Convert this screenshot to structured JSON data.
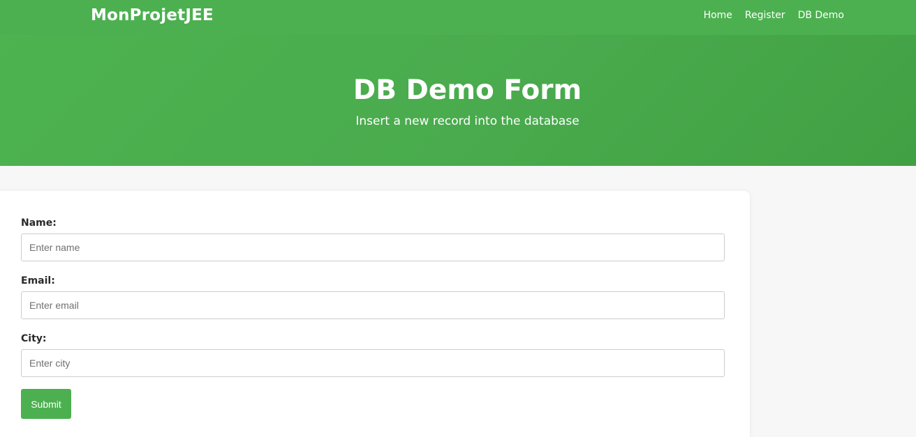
{
  "navbar": {
    "brand": "MonProjetJEE",
    "links": [
      {
        "label": "Home"
      },
      {
        "label": "Register"
      },
      {
        "label": "DB Demo"
      }
    ]
  },
  "hero": {
    "title": "DB Demo Form",
    "subtitle": "Insert a new record into the database"
  },
  "form": {
    "fields": [
      {
        "label": "Name:",
        "placeholder": "Enter name",
        "value": ""
      },
      {
        "label": "Email:",
        "placeholder": "Enter email",
        "value": ""
      },
      {
        "label": "City:",
        "placeholder": "Enter city",
        "value": ""
      }
    ],
    "submit_label": "Submit"
  },
  "colors": {
    "accent_green": "#4cb050",
    "page_background": "#f7f7f7",
    "card_background": "#ffffff"
  }
}
